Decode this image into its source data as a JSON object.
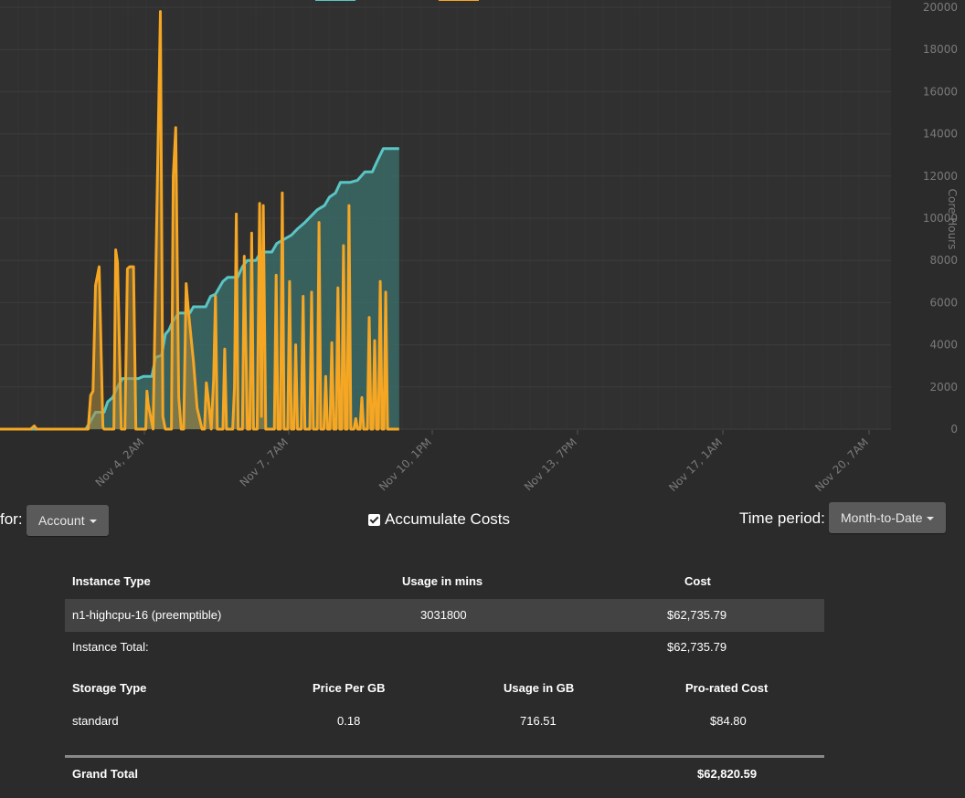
{
  "chart_data": {
    "type": "area",
    "y_axis": {
      "label": "Core Hours",
      "min": 0,
      "max": 20000,
      "ticks": [
        "0",
        "2000",
        "4000",
        "6000",
        "8000",
        "10000",
        "12000",
        "14000",
        "16000",
        "18000",
        "20000"
      ]
    },
    "x_axis": {
      "ticks": [
        "Nov 4, 2AM",
        "Nov 7, 7AM",
        "Nov 10, 1PM",
        "Nov 13, 7PM",
        "Nov 17, 1AM",
        "Nov 20, 7AM"
      ],
      "start": "Nov 1, 12AM",
      "end": "Nov 20, 7PM"
    },
    "grid": true,
    "series": [
      {
        "color": "#5ac5c5",
        "fill": "#3a6a66",
        "points": [
          [
            0,
            0
          ],
          [
            7,
            0
          ],
          [
            7.3,
            280
          ],
          [
            7.8,
            800
          ],
          [
            8.5,
            800
          ],
          [
            8.8,
            1300
          ],
          [
            9.2,
            1500
          ],
          [
            9.6,
            2000
          ],
          [
            10,
            2400
          ],
          [
            11.3,
            2400
          ],
          [
            11.7,
            2500
          ],
          [
            12.4,
            2500
          ],
          [
            12.7,
            3400
          ],
          [
            13.2,
            3500
          ],
          [
            13.5,
            4500
          ],
          [
            13.8,
            4700
          ],
          [
            14.1,
            5100
          ],
          [
            14.6,
            5500
          ],
          [
            15.5,
            5500
          ],
          [
            15.8,
            5800
          ],
          [
            16.8,
            5800
          ],
          [
            17.2,
            6300
          ],
          [
            17.6,
            6400
          ],
          [
            18.2,
            7000
          ],
          [
            18.6,
            7200
          ],
          [
            19.4,
            7200
          ],
          [
            19.8,
            7700
          ],
          [
            20.2,
            8000
          ],
          [
            20.9,
            8000
          ],
          [
            21.3,
            8400
          ],
          [
            22.2,
            8400
          ],
          [
            22.6,
            8800
          ],
          [
            23.2,
            9000
          ],
          [
            23.8,
            9200
          ],
          [
            24.3,
            9500
          ],
          [
            24.9,
            9800
          ],
          [
            25.4,
            10100
          ],
          [
            25.9,
            10400
          ],
          [
            26.5,
            10600
          ],
          [
            26.9,
            11000
          ],
          [
            27.4,
            11200
          ],
          [
            27.8,
            11700
          ],
          [
            28.6,
            11700
          ],
          [
            29.2,
            11800
          ],
          [
            29.8,
            12200
          ],
          [
            30.4,
            12200
          ],
          [
            30.8,
            12700
          ],
          [
            31.3,
            13300
          ],
          [
            32.6,
            13300
          ]
        ]
      },
      {
        "color": "#f5a623",
        "fill": "#b08a3a",
        "points": [
          [
            0,
            0
          ],
          [
            2.5,
            0
          ],
          [
            2.8,
            150
          ],
          [
            3,
            0
          ],
          [
            7.2,
            0
          ],
          [
            7.4,
            1600
          ],
          [
            7.6,
            1800
          ],
          [
            7.8,
            6800
          ],
          [
            8.1,
            7700
          ],
          [
            8.4,
            100
          ],
          [
            8.5,
            0
          ],
          [
            9.3,
            0
          ],
          [
            9.45,
            8500
          ],
          [
            9.6,
            7900
          ],
          [
            9.9,
            0
          ],
          [
            10.2,
            0
          ],
          [
            10.4,
            7600
          ],
          [
            10.6,
            7700
          ],
          [
            10.9,
            7700
          ],
          [
            11.1,
            0
          ],
          [
            11.9,
            0
          ],
          [
            12.0,
            1800
          ],
          [
            12.1,
            1200
          ],
          [
            12.5,
            0
          ],
          [
            13.1,
            19800
          ],
          [
            13.3,
            600
          ],
          [
            13.5,
            0
          ],
          [
            14.0,
            0
          ],
          [
            14.15,
            12000
          ],
          [
            14.35,
            14300
          ],
          [
            14.6,
            1500
          ],
          [
            14.8,
            0
          ],
          [
            15.0,
            0
          ],
          [
            15.2,
            6900
          ],
          [
            15.4,
            5500
          ],
          [
            15.8,
            3200
          ],
          [
            16.1,
            1000
          ],
          [
            16.5,
            0
          ],
          [
            16.7,
            0
          ],
          [
            16.85,
            2200
          ],
          [
            17,
            1500
          ],
          [
            17.25,
            0
          ],
          [
            17.45,
            2400
          ],
          [
            17.6,
            6300
          ],
          [
            17.75,
            0
          ],
          [
            18.2,
            0
          ],
          [
            18.35,
            3800
          ],
          [
            18.5,
            0
          ],
          [
            19.0,
            0
          ],
          [
            19.15,
            2000
          ],
          [
            19.3,
            10200
          ],
          [
            19.45,
            0
          ],
          [
            19.8,
            0
          ],
          [
            19.95,
            8200
          ],
          [
            20.1,
            3500
          ],
          [
            20.2,
            0
          ],
          [
            20.4,
            0
          ],
          [
            20.55,
            9300
          ],
          [
            20.7,
            0
          ],
          [
            21.0,
            0
          ],
          [
            21.2,
            10700
          ],
          [
            21.35,
            600
          ],
          [
            21.5,
            10600
          ],
          [
            21.7,
            0
          ],
          [
            22.4,
            0
          ],
          [
            22.55,
            7300
          ],
          [
            22.7,
            0
          ],
          [
            22.9,
            0
          ],
          [
            23.05,
            11200
          ],
          [
            23.2,
            0
          ],
          [
            23.5,
            0
          ],
          [
            23.65,
            7000
          ],
          [
            23.8,
            0
          ],
          [
            24.0,
            0
          ],
          [
            24.15,
            4000
          ],
          [
            24.3,
            0
          ],
          [
            24.6,
            0
          ],
          [
            24.75,
            6300
          ],
          [
            24.9,
            0
          ],
          [
            25.3,
            0
          ],
          [
            25.45,
            6500
          ],
          [
            25.6,
            0
          ],
          [
            25.9,
            0
          ],
          [
            26.05,
            9800
          ],
          [
            26.2,
            0
          ],
          [
            26.45,
            0
          ],
          [
            26.6,
            2500
          ],
          [
            26.75,
            0
          ],
          [
            26.95,
            0
          ],
          [
            27.1,
            4100
          ],
          [
            27.25,
            0
          ],
          [
            27.45,
            0
          ],
          [
            27.6,
            6700
          ],
          [
            27.75,
            0
          ],
          [
            27.9,
            0
          ],
          [
            28.05,
            8700
          ],
          [
            28.2,
            0
          ],
          [
            28.35,
            0
          ],
          [
            28.5,
            10600
          ],
          [
            28.65,
            0
          ],
          [
            28.9,
            0
          ],
          [
            29.05,
            500
          ],
          [
            29.2,
            0
          ],
          [
            29.4,
            0
          ],
          [
            29.55,
            1500
          ],
          [
            29.7,
            0
          ],
          [
            30.0,
            0
          ],
          [
            30.15,
            5300
          ],
          [
            30.3,
            0
          ],
          [
            30.45,
            0
          ],
          [
            30.6,
            4200
          ],
          [
            30.75,
            0
          ],
          [
            30.9,
            0
          ],
          [
            31.05,
            7000
          ],
          [
            31.2,
            0
          ],
          [
            31.35,
            0
          ],
          [
            31.5,
            6500
          ],
          [
            31.65,
            0
          ],
          [
            32.6,
            0
          ]
        ]
      }
    ]
  },
  "controls": {
    "for_label": "for:",
    "account_button": "Account",
    "accumulate_label": "Accumulate Costs",
    "accumulate_checked": true,
    "time_period_label": "Time period:",
    "time_period_button": "Month-to-Date"
  },
  "instance_table": {
    "headers": [
      "Instance Type",
      "Usage in mins",
      "Cost"
    ],
    "rows": [
      {
        "type": "n1-highcpu-16 (preemptible)",
        "usage": "3031800",
        "cost": "$62,735.79"
      }
    ],
    "total_label": "Instance Total:",
    "total_value": "$62,735.79"
  },
  "storage_table": {
    "headers": [
      "Storage Type",
      "Price Per GB",
      "Usage in GB",
      "Pro-rated Cost"
    ],
    "rows": [
      {
        "type": "standard",
        "price": "0.18",
        "usage": "716.51",
        "cost": "$84.80"
      }
    ]
  },
  "grand_total": {
    "label": "Grand Total",
    "value": "$62,820.59"
  }
}
